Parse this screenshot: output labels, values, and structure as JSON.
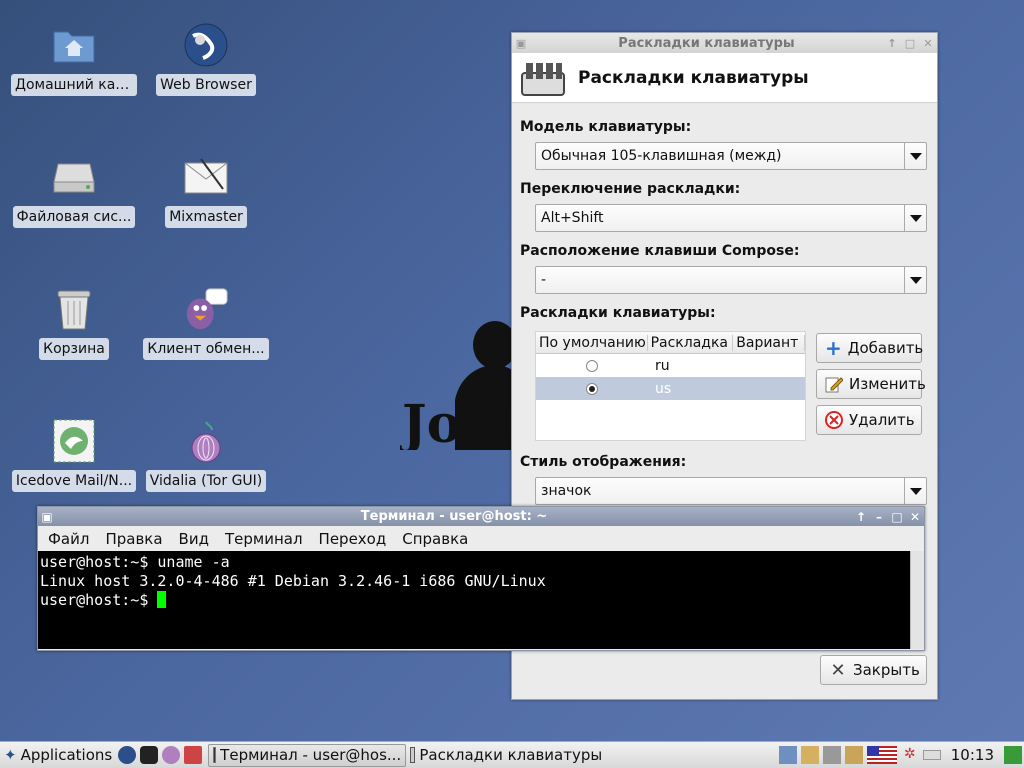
{
  "desktop": {
    "icons": [
      {
        "label": "Домашний кат...",
        "icon": "home-folder-icon"
      },
      {
        "label": "Web Browser",
        "icon": "web-browser-icon"
      },
      {
        "label": "Файловая сис...",
        "icon": "hard-drive-icon"
      },
      {
        "label": "Mixmaster",
        "icon": "mail-envelope-icon"
      },
      {
        "label": "Корзина",
        "icon": "trash-icon"
      },
      {
        "label": "Клиент обмен...",
        "icon": "pidgin-icon"
      },
      {
        "label": "Icedove Mail/N...",
        "icon": "icedove-icon"
      },
      {
        "label": "Vidalia (Tor GUI)",
        "icon": "onion-icon"
      }
    ],
    "logo_text": "JonD"
  },
  "keyboard_window": {
    "title": "Раскладки клавиатуры",
    "header": "Раскладки клавиатуры",
    "model_label": "Модель клавиатуры:",
    "model_value": "Обычная 105-клавишная (межд)",
    "switch_label": "Переключение раскладки:",
    "switch_value": "Alt+Shift",
    "compose_label": "Расположение клавиши Compose:",
    "compose_value": "-",
    "layouts_label": "Раскладки клавиатуры:",
    "columns": [
      "По умолчанию",
      "Раскладка",
      "Вариант"
    ],
    "layouts": [
      {
        "code": "ru",
        "default": false,
        "selected": false
      },
      {
        "code": "us",
        "default": true,
        "selected": true
      }
    ],
    "add_button": "Добавить",
    "edit_button": "Изменить",
    "delete_button": "Удалить",
    "style_label": "Стиль отображения:",
    "style_value": "значок",
    "close_button": "Закрыть"
  },
  "terminal": {
    "title": "Терминал - user@host: ~",
    "menu": [
      "Файл",
      "Правка",
      "Вид",
      "Терминал",
      "Переход",
      "Справка"
    ],
    "lines": [
      "user@host:~$ uname -a",
      "Linux host 3.2.0-4-486 #1 Debian 3.2.46-1 i686 GNU/Linux",
      "user@host:~$ "
    ]
  },
  "taskbar": {
    "applications": "Applications",
    "tasks": [
      "Терминал - user@hos...",
      "Раскладки клавиатуры"
    ],
    "clock": "10:13"
  }
}
